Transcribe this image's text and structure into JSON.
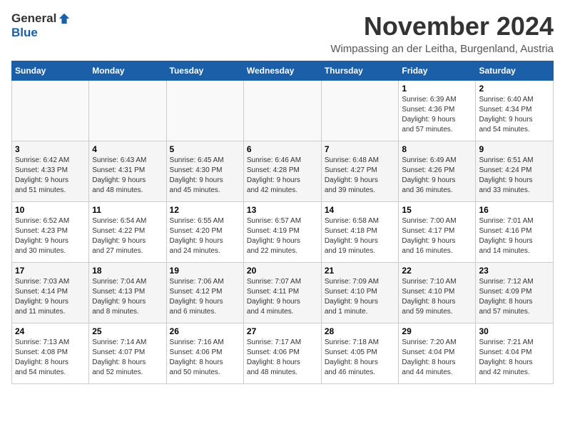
{
  "header": {
    "logo_general": "General",
    "logo_blue": "Blue",
    "month_title": "November 2024",
    "location": "Wimpassing an der Leitha, Burgenland, Austria"
  },
  "weekdays": [
    "Sunday",
    "Monday",
    "Tuesday",
    "Wednesday",
    "Thursday",
    "Friday",
    "Saturday"
  ],
  "weeks": [
    [
      {
        "day": "",
        "info": ""
      },
      {
        "day": "",
        "info": ""
      },
      {
        "day": "",
        "info": ""
      },
      {
        "day": "",
        "info": ""
      },
      {
        "day": "",
        "info": ""
      },
      {
        "day": "1",
        "info": "Sunrise: 6:39 AM\nSunset: 4:36 PM\nDaylight: 9 hours\nand 57 minutes."
      },
      {
        "day": "2",
        "info": "Sunrise: 6:40 AM\nSunset: 4:34 PM\nDaylight: 9 hours\nand 54 minutes."
      }
    ],
    [
      {
        "day": "3",
        "info": "Sunrise: 6:42 AM\nSunset: 4:33 PM\nDaylight: 9 hours\nand 51 minutes."
      },
      {
        "day": "4",
        "info": "Sunrise: 6:43 AM\nSunset: 4:31 PM\nDaylight: 9 hours\nand 48 minutes."
      },
      {
        "day": "5",
        "info": "Sunrise: 6:45 AM\nSunset: 4:30 PM\nDaylight: 9 hours\nand 45 minutes."
      },
      {
        "day": "6",
        "info": "Sunrise: 6:46 AM\nSunset: 4:28 PM\nDaylight: 9 hours\nand 42 minutes."
      },
      {
        "day": "7",
        "info": "Sunrise: 6:48 AM\nSunset: 4:27 PM\nDaylight: 9 hours\nand 39 minutes."
      },
      {
        "day": "8",
        "info": "Sunrise: 6:49 AM\nSunset: 4:26 PM\nDaylight: 9 hours\nand 36 minutes."
      },
      {
        "day": "9",
        "info": "Sunrise: 6:51 AM\nSunset: 4:24 PM\nDaylight: 9 hours\nand 33 minutes."
      }
    ],
    [
      {
        "day": "10",
        "info": "Sunrise: 6:52 AM\nSunset: 4:23 PM\nDaylight: 9 hours\nand 30 minutes."
      },
      {
        "day": "11",
        "info": "Sunrise: 6:54 AM\nSunset: 4:22 PM\nDaylight: 9 hours\nand 27 minutes."
      },
      {
        "day": "12",
        "info": "Sunrise: 6:55 AM\nSunset: 4:20 PM\nDaylight: 9 hours\nand 24 minutes."
      },
      {
        "day": "13",
        "info": "Sunrise: 6:57 AM\nSunset: 4:19 PM\nDaylight: 9 hours\nand 22 minutes."
      },
      {
        "day": "14",
        "info": "Sunrise: 6:58 AM\nSunset: 4:18 PM\nDaylight: 9 hours\nand 19 minutes."
      },
      {
        "day": "15",
        "info": "Sunrise: 7:00 AM\nSunset: 4:17 PM\nDaylight: 9 hours\nand 16 minutes."
      },
      {
        "day": "16",
        "info": "Sunrise: 7:01 AM\nSunset: 4:16 PM\nDaylight: 9 hours\nand 14 minutes."
      }
    ],
    [
      {
        "day": "17",
        "info": "Sunrise: 7:03 AM\nSunset: 4:14 PM\nDaylight: 9 hours\nand 11 minutes."
      },
      {
        "day": "18",
        "info": "Sunrise: 7:04 AM\nSunset: 4:13 PM\nDaylight: 9 hours\nand 8 minutes."
      },
      {
        "day": "19",
        "info": "Sunrise: 7:06 AM\nSunset: 4:12 PM\nDaylight: 9 hours\nand 6 minutes."
      },
      {
        "day": "20",
        "info": "Sunrise: 7:07 AM\nSunset: 4:11 PM\nDaylight: 9 hours\nand 4 minutes."
      },
      {
        "day": "21",
        "info": "Sunrise: 7:09 AM\nSunset: 4:10 PM\nDaylight: 9 hours\nand 1 minute."
      },
      {
        "day": "22",
        "info": "Sunrise: 7:10 AM\nSunset: 4:10 PM\nDaylight: 8 hours\nand 59 minutes."
      },
      {
        "day": "23",
        "info": "Sunrise: 7:12 AM\nSunset: 4:09 PM\nDaylight: 8 hours\nand 57 minutes."
      }
    ],
    [
      {
        "day": "24",
        "info": "Sunrise: 7:13 AM\nSunset: 4:08 PM\nDaylight: 8 hours\nand 54 minutes."
      },
      {
        "day": "25",
        "info": "Sunrise: 7:14 AM\nSunset: 4:07 PM\nDaylight: 8 hours\nand 52 minutes."
      },
      {
        "day": "26",
        "info": "Sunrise: 7:16 AM\nSunset: 4:06 PM\nDaylight: 8 hours\nand 50 minutes."
      },
      {
        "day": "27",
        "info": "Sunrise: 7:17 AM\nSunset: 4:06 PM\nDaylight: 8 hours\nand 48 minutes."
      },
      {
        "day": "28",
        "info": "Sunrise: 7:18 AM\nSunset: 4:05 PM\nDaylight: 8 hours\nand 46 minutes."
      },
      {
        "day": "29",
        "info": "Sunrise: 7:20 AM\nSunset: 4:04 PM\nDaylight: 8 hours\nand 44 minutes."
      },
      {
        "day": "30",
        "info": "Sunrise: 7:21 AM\nSunset: 4:04 PM\nDaylight: 8 hours\nand 42 minutes."
      }
    ]
  ]
}
